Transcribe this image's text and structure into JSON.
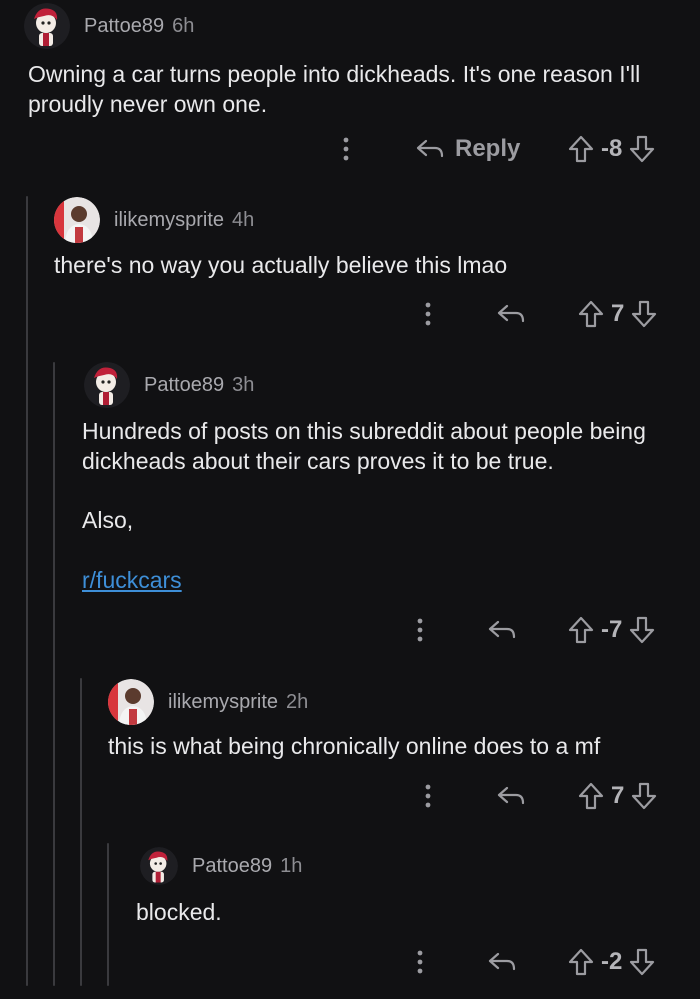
{
  "comments": [
    {
      "user": "Pattoe89",
      "age": "6h",
      "text": "Owning a car turns people into dickheads. It's one reason I'll\nproudly never own one.",
      "score": "-8",
      "reply_label": "Reply"
    },
    {
      "user": "ilikemysprite",
      "age": "4h",
      "text": "there's no way you actually believe this lmao",
      "score": "7"
    },
    {
      "user": "Pattoe89",
      "age": "3h",
      "text": "Hundreds of posts on this subreddit about people being\ndickheads about their cars proves it to be true.",
      "text2": "Also,",
      "link": "r/fuckcars",
      "score": "-7"
    },
    {
      "user": "ilikemysprite",
      "age": "2h",
      "text": "this is what being chronically online does to a mf",
      "score": "7"
    },
    {
      "user": "Pattoe89",
      "age": "1h",
      "text": "blocked.",
      "score": "-2"
    }
  ],
  "icons": {
    "more": "more-vertical-icon",
    "reply": "reply-arrow-icon",
    "upvote": "upvote-arrow-icon",
    "downvote": "downvote-arrow-icon"
  },
  "colors": {
    "background": "#111113",
    "link": "#3e8fd8",
    "thread_line": "#3a3a3e"
  }
}
